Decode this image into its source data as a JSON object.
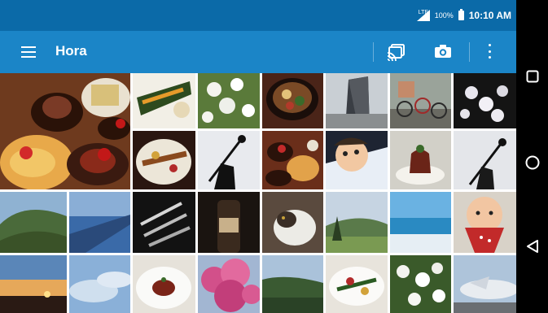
{
  "status_bar": {
    "network": "LTE",
    "battery": "100%",
    "time": "10:10 AM"
  },
  "app_bar": {
    "title": "Hora",
    "menu_icon": "hamburger-menu-icon",
    "actions": [
      "cast-icon",
      "camera-icon",
      "overflow-menu-icon"
    ]
  },
  "gallery": {
    "photos": [
      {
        "subject": "dessert-plates"
      },
      {
        "subject": "plated-dish"
      },
      {
        "subject": "white-flowers"
      },
      {
        "subject": "bowl-of-food"
      },
      {
        "subject": "tall-building"
      },
      {
        "subject": "bicycles-street"
      },
      {
        "subject": "cherry-blossoms-night"
      },
      {
        "subject": "dessert-plate"
      },
      {
        "subject": "selfie-stick-silhouette"
      },
      {
        "subject": "cake-plates"
      },
      {
        "subject": "baby"
      },
      {
        "subject": "dessert-dome"
      },
      {
        "subject": "selfie-stick-sky"
      },
      {
        "subject": "coastal-mountain"
      },
      {
        "subject": "airplane-wing"
      },
      {
        "subject": "dark-objects"
      },
      {
        "subject": "wine-bottle"
      },
      {
        "subject": "cat"
      },
      {
        "subject": "green-valley"
      },
      {
        "subject": "ocean-waves"
      },
      {
        "subject": "baby-bib"
      },
      {
        "subject": "sunset-town"
      },
      {
        "subject": "clouds-sky"
      },
      {
        "subject": "dessert-white-plate"
      },
      {
        "subject": "pink-blossoms"
      },
      {
        "subject": "green-hillside"
      },
      {
        "subject": "food-platter"
      },
      {
        "subject": "white-flowers-bush"
      },
      {
        "subject": "airplane-at-gate"
      }
    ]
  },
  "navigation_bar": {
    "buttons": [
      "recent-apps-icon",
      "home-icon",
      "back-icon"
    ]
  }
}
